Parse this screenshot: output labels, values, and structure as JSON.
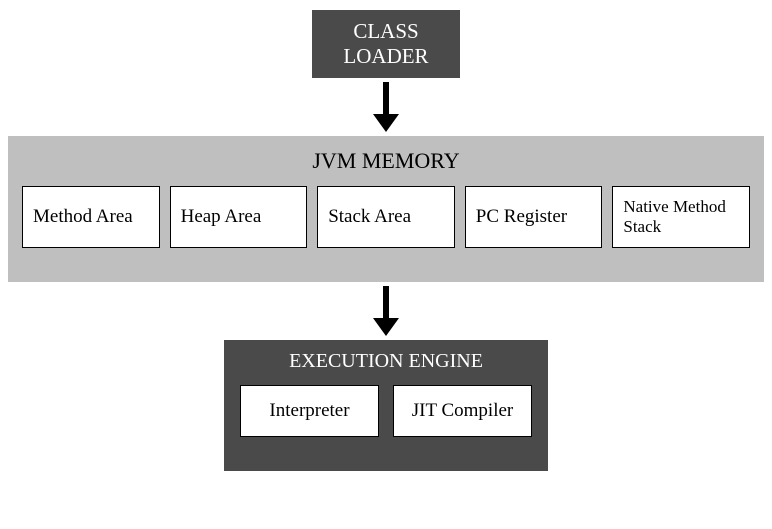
{
  "classLoader": {
    "line1": "CLASS",
    "line2": "LOADER"
  },
  "jvmMemory": {
    "title": "JVM MEMORY",
    "boxes": [
      "Method Area",
      "Heap Area",
      "Stack Area",
      "PC Register",
      "Native Method Stack"
    ]
  },
  "executionEngine": {
    "title": "EXECUTION ENGINE",
    "boxes": [
      "Interpreter",
      "JIT Compiler"
    ]
  }
}
